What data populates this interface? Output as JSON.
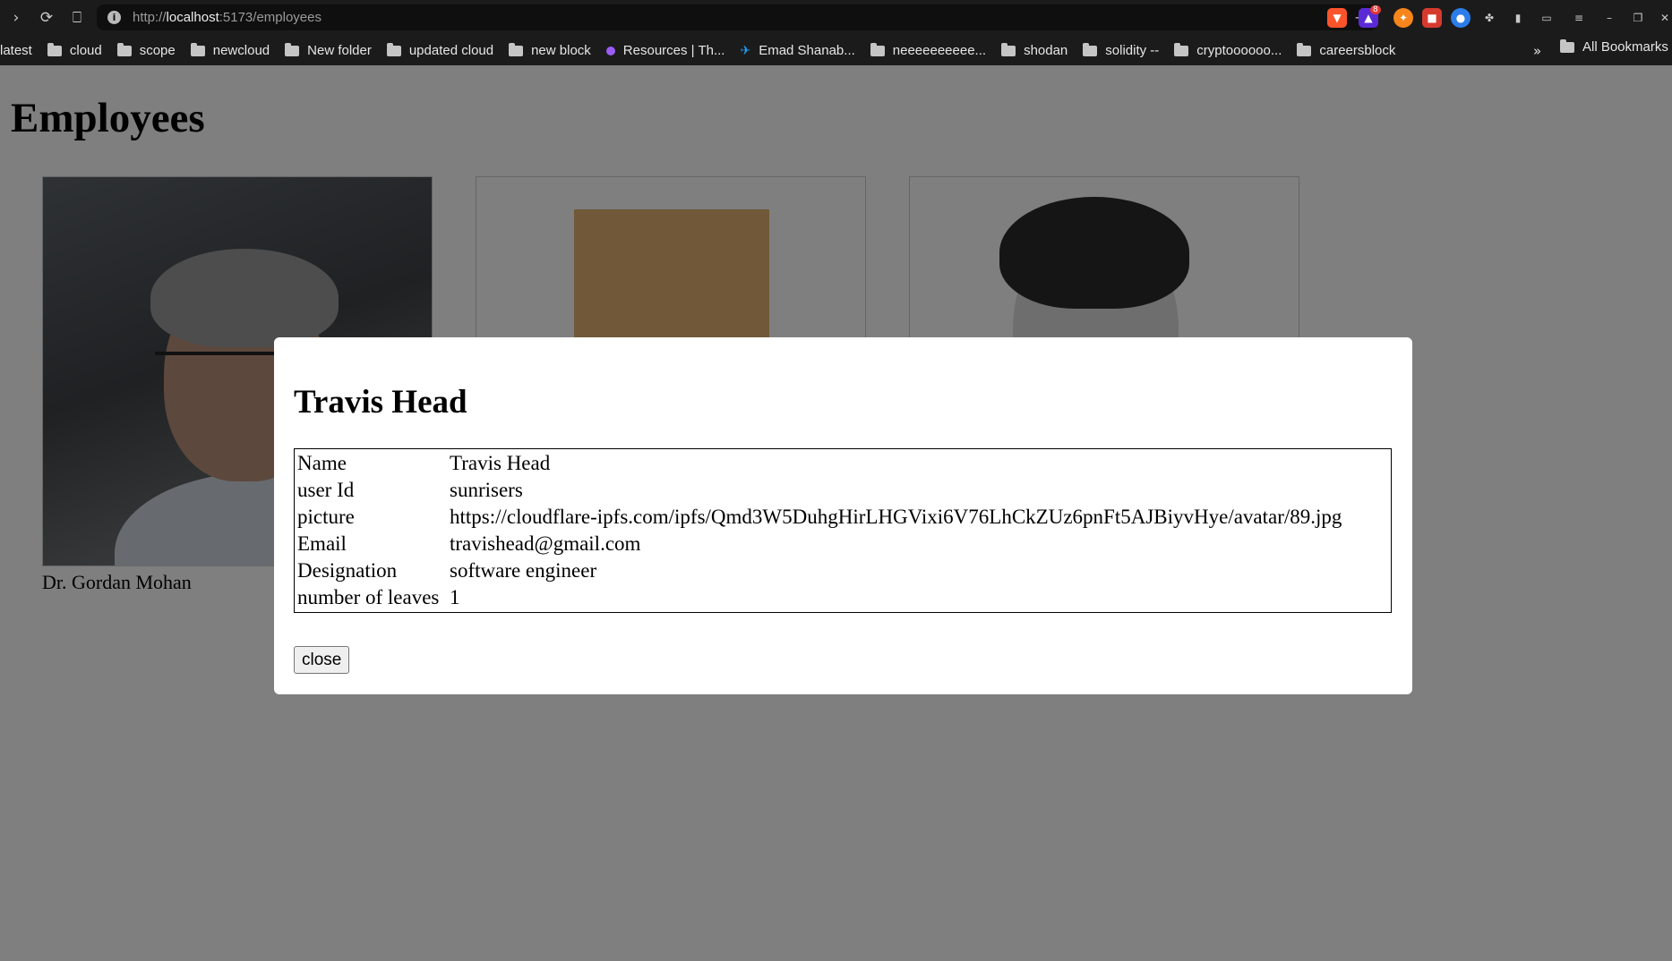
{
  "browser": {
    "url_scheme": "http://",
    "url_host": "localhost",
    "url_path": ":5173/employees",
    "extension_badge": "8",
    "bookmarks": [
      {
        "label": "latest",
        "icon": "none"
      },
      {
        "label": "cloud",
        "icon": "folder-icon"
      },
      {
        "label": "scope",
        "icon": "folder-icon"
      },
      {
        "label": "newcloud",
        "icon": "folder-icon"
      },
      {
        "label": "New folder",
        "icon": "folder-icon"
      },
      {
        "label": "updated cloud",
        "icon": "folder-icon"
      },
      {
        "label": "new block",
        "icon": "folder-icon"
      },
      {
        "label": "Resources | Th...",
        "icon": "dot-icon"
      },
      {
        "label": "Emad Shanab...",
        "icon": "twitter-icon"
      },
      {
        "label": "neeeeeeeeee...",
        "icon": "folder-icon"
      },
      {
        "label": "shodan",
        "icon": "folder-icon"
      },
      {
        "label": "solidity --",
        "icon": "folder-icon"
      },
      {
        "label": "cryptoooooo...",
        "icon": "folder-icon"
      },
      {
        "label": "careersblock",
        "icon": "folder-icon"
      }
    ],
    "more_label": "»",
    "all_bookmarks_label": "All Bookmarks"
  },
  "page": {
    "title": "Employees",
    "employees": [
      {
        "name": "Dr. Gordan Mohan"
      },
      {
        "name": ""
      },
      {
        "name": ""
      }
    ]
  },
  "modal": {
    "title": "Travis Head",
    "rows": [
      {
        "key": "Name",
        "value": "Travis Head"
      },
      {
        "key": "user Id",
        "value": "sunrisers"
      },
      {
        "key": "picture",
        "value": "https://cloudflare-ipfs.com/ipfs/Qmd3W5DuhgHirLHGVixi6V76LhCkZUz6pnFt5AJBiyvHye/avatar/89.jpg"
      },
      {
        "key": "Email",
        "value": "travishead@gmail.com"
      },
      {
        "key": "Designation",
        "value": "software engineer"
      },
      {
        "key": "number of leaves",
        "value": "1"
      }
    ],
    "close_label": "close"
  },
  "colors": {
    "overlay": "rgba(0,0,0,0.5)",
    "chrome_bg": "#1b1b1c",
    "card2_fill": "#e0b170"
  }
}
